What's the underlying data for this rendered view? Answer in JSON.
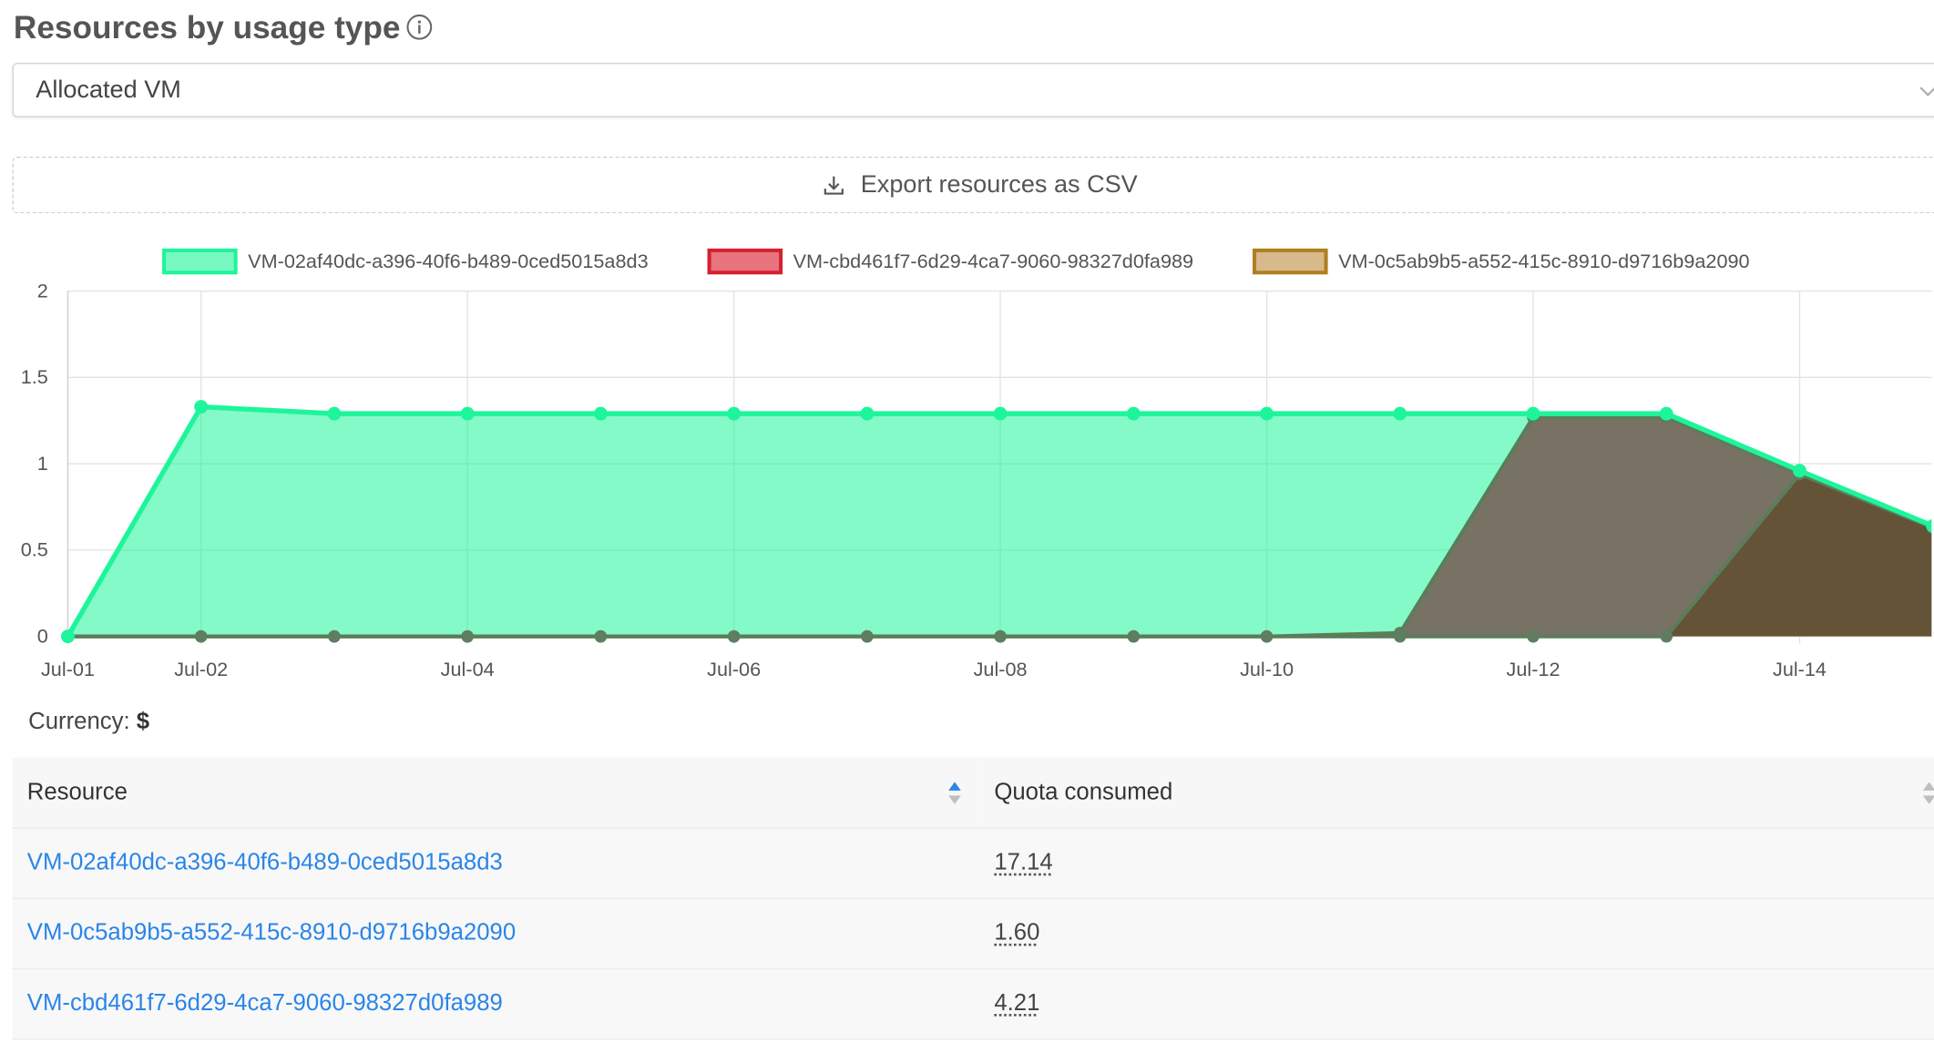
{
  "header": {
    "title": "Resources by usage type"
  },
  "usage_type_select": {
    "value": "Allocated VM"
  },
  "export": {
    "label": "Export resources as CSV"
  },
  "currency": {
    "label": "Currency:",
    "symbol": "$"
  },
  "chart_data": {
    "type": "area",
    "x": [
      "Jul-01",
      "Jul-02",
      "Jul-03",
      "Jul-04",
      "Jul-05",
      "Jul-06",
      "Jul-07",
      "Jul-08",
      "Jul-09",
      "Jul-10",
      "Jul-11",
      "Jul-12",
      "Jul-13",
      "Jul-14",
      "Jul-15"
    ],
    "xtick_labels": [
      "Jul-01",
      "Jul-02",
      "Jul-04",
      "Jul-06",
      "Jul-08",
      "Jul-10",
      "Jul-12",
      "Jul-14"
    ],
    "ytick_labels": [
      "0",
      "0.5",
      "1",
      "1.5",
      "2"
    ],
    "ylim": [
      0,
      2
    ],
    "grid": true,
    "legend_position": "top",
    "series": [
      {
        "name": "VM-02af40dc-a396-40f6-b489-0ced5015a8d3",
        "color": "#1ef59b",
        "fill": "rgba(30,245,155,0.55)",
        "values": [
          0,
          1.33,
          1.29,
          1.29,
          1.29,
          1.29,
          1.29,
          1.29,
          1.29,
          1.29,
          1.29,
          1.29,
          1.29,
          0.96,
          0.64
        ]
      },
      {
        "name": "VM-cbd461f7-6d29-4ca7-9060-98327d0fa989",
        "color": "#d62030",
        "fill": "rgba(232,116,128,1)",
        "values": [
          0,
          0,
          0,
          0,
          0,
          0,
          0,
          0,
          0,
          0,
          0.02,
          1.27,
          1.27,
          0.94,
          0.63
        ]
      },
      {
        "name": "VM-0c5ab9b5-a552-415c-8910-d9716b9a2090",
        "color": "#b07e20",
        "fill": "rgba(215,185,140,1)",
        "values": [
          0,
          0,
          0,
          0,
          0,
          0,
          0,
          0,
          0,
          0,
          0,
          0,
          0,
          0.94,
          0.63
        ]
      }
    ]
  },
  "table": {
    "columns": [
      "Resource",
      "Quota consumed"
    ],
    "rows": [
      {
        "resource": "VM-02af40dc-a396-40f6-b489-0ced5015a8d3",
        "quota": "17.14"
      },
      {
        "resource": "VM-0c5ab9b5-a552-415c-8910-d9716b9a2090",
        "quota": "1.60"
      },
      {
        "resource": "VM-cbd461f7-6d29-4ca7-9060-98327d0fa989",
        "quota": "4.21"
      }
    ]
  }
}
